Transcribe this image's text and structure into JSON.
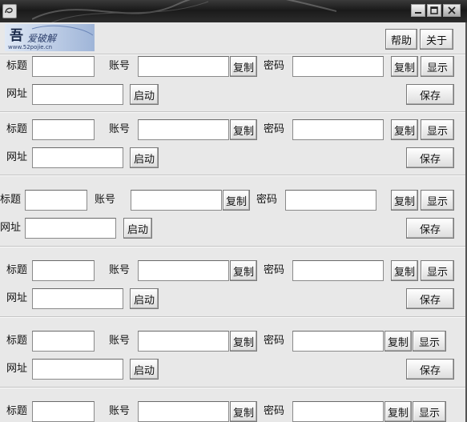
{
  "header": {
    "help_label": "帮助",
    "about_label": "关于"
  },
  "labels": {
    "title": "标题",
    "account": "账号",
    "password": "密码",
    "url": "网址",
    "copy": "复制",
    "show": "显示",
    "launch": "启动",
    "save": "保存"
  },
  "records": [
    {
      "title": "",
      "account": "",
      "password": "",
      "url": ""
    },
    {
      "title": "",
      "account": "",
      "password": "",
      "url": ""
    },
    {
      "title": "",
      "account": "",
      "password": "",
      "url": ""
    },
    {
      "title": "",
      "account": "",
      "password": "",
      "url": ""
    },
    {
      "title": "",
      "account": "",
      "password": "",
      "url": ""
    },
    {
      "title": "",
      "account": "",
      "password": ""
    }
  ],
  "logo_text": "吾爱破解",
  "logo_url_text": "www.52pojie.cn"
}
